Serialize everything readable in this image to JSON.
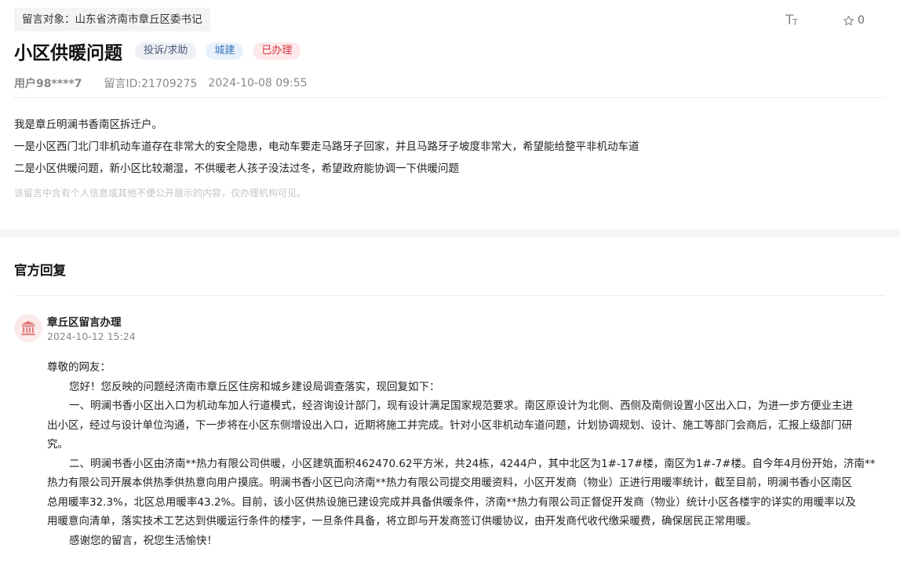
{
  "header": {
    "target_label": "留言对象：山东省济南市章丘区委书记",
    "font_size_icon": "text-size-icon",
    "star_icon": "star-outline-icon",
    "star_count": "0"
  },
  "post": {
    "title": "小区供暖问题",
    "tags": {
      "type": "投诉/求助",
      "department": "城建",
      "status": "已办理"
    },
    "user": "用户98****7",
    "message_id": "留言ID:21709275",
    "datetime": "2024-10-08 09:55",
    "body": [
      "我是章丘明澜书香南区拆迁户。",
      "一是小区西门北门非机动车道存在非常大的安全隐患，电动车要走马路牙子回家，并且马路牙子坡度非常大，希望能给整平非机动车道",
      "二是小区供暖问题，新小区比较潮湿，不供暖老人孩子没法过冬，希望政府能协调一下供暖问题"
    ],
    "privacy_note": "该留言中含有个人信息或其他不便公开展示的内容，仅办理机构可见。"
  },
  "reply": {
    "heading": "官方回复",
    "department": "章丘区留言办理",
    "datetime": "2024-10-12 15:24",
    "avatar_icon": "government-building-icon",
    "lines": [
      "尊敬的网友：",
      "您好！您反映的问题经济南市章丘区住房和城乡建设局调查落实，现回复如下：",
      "一、明澜书香小区出入口为机动车加人行道模式，经咨询设计部门，现有设计满足国家规范要求。南区原设计为北侧、西侧及南侧设置小区出入口，为进一步方便业主进",
      "出小区，经过与设计单位沟通，下一步将在小区东侧增设出入口，近期将施工并完成。针对小区非机动车道问题，计划协调规划、设计、施工等部门会商后，汇报上级部门研",
      "究。",
      "二、明澜书香小区由济南**热力有限公司供暖，小区建筑面积462470.62平方米，共24栋，4244户，其中北区为1#-17#楼，南区为1#-7#楼。自今年4月份开始，济南**",
      "热力有限公司开展本供热季供热意向用户摸底。明澜书香小区已向济南**热力有限公司提交用暖资料，小区开发商（物业）正进行用暖率统计，截至目前，明澜书香小区南区",
      "总用暖率32.3%，北区总用暖率43.2%。目前，该小区供热设施已建设完成并具备供暖条件，济南**热力有限公司正督促开发商（物业）统计小区各楼宇的详实的用暖率以及",
      "用暖意向清单，落实技术工艺达到供暖运行条件的楼宇，一旦条件具备，将立即与开发商签订供暖协议，由开发商代收代缴采暖费，确保居民正常用暖。",
      "感谢您的留言，祝您生活愉快！"
    ]
  },
  "colors": {
    "accent_red": "#d9363e",
    "accent_blue": "#3a78c2",
    "avatar_bg": "#fbeaea",
    "avatar_icon": "#e07a7a"
  }
}
